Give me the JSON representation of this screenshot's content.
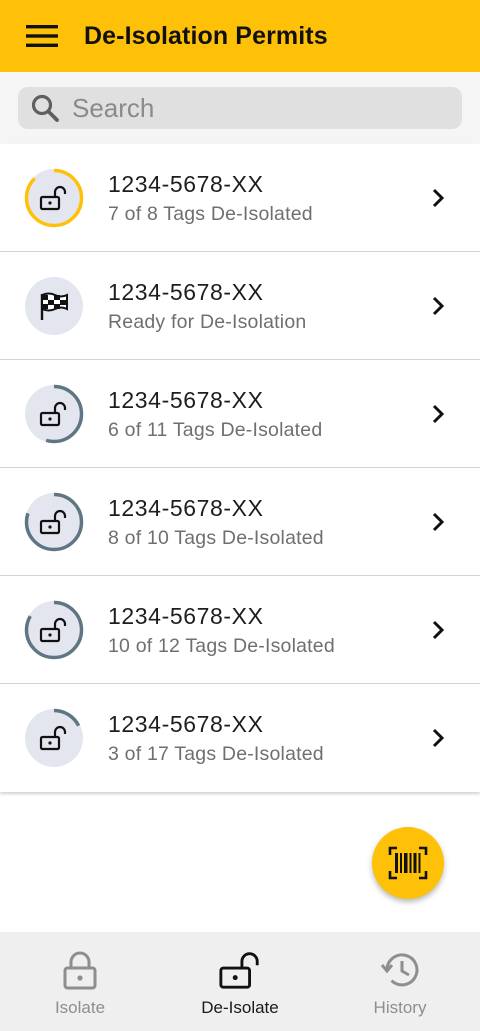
{
  "app_bar": {
    "title": "De-Isolation Permits",
    "menu_icon": "hamburger-menu-icon"
  },
  "search": {
    "placeholder": "Search",
    "value": ""
  },
  "permits": [
    {
      "id": "1234-5678-XX",
      "status": "7 of 8 Tags De-Isolated",
      "progress": 0.875,
      "icon": "unlock-icon",
      "ring_color": "#ffc107"
    },
    {
      "id": "1234-5678-XX",
      "status": "Ready for De-Isolation",
      "progress": 0,
      "icon": "checkered-flag-icon",
      "ring_color": "#5f7583"
    },
    {
      "id": "1234-5678-XX",
      "status": "6 of 11 Tags De-Isolated",
      "progress": 0.545,
      "icon": "unlock-icon",
      "ring_color": "#5f7583"
    },
    {
      "id": "1234-5678-XX",
      "status": "8 of 10 Tags De-Isolated",
      "progress": 0.8,
      "icon": "unlock-icon",
      "ring_color": "#5f7583"
    },
    {
      "id": "1234-5678-XX",
      "status": "10 of 12 Tags De-Isolated",
      "progress": 0.833,
      "icon": "unlock-icon",
      "ring_color": "#5f7583"
    },
    {
      "id": "1234-5678-XX",
      "status": "3 of 17 Tags De-Isolated",
      "progress": 0.176,
      "icon": "unlock-icon",
      "ring_color": "#5f7583"
    }
  ],
  "fab": {
    "icon": "barcode-scan-icon"
  },
  "bottom_nav": [
    {
      "label": "Isolate",
      "icon": "lock-icon",
      "active": false
    },
    {
      "label": "De-Isolate",
      "icon": "unlock-icon",
      "active": true
    },
    {
      "label": "History",
      "icon": "history-icon",
      "active": false
    }
  ],
  "colors": {
    "accent": "#ffc107",
    "progress_ring": "#5f7583",
    "avatar_bg": "#e3e6ee"
  }
}
